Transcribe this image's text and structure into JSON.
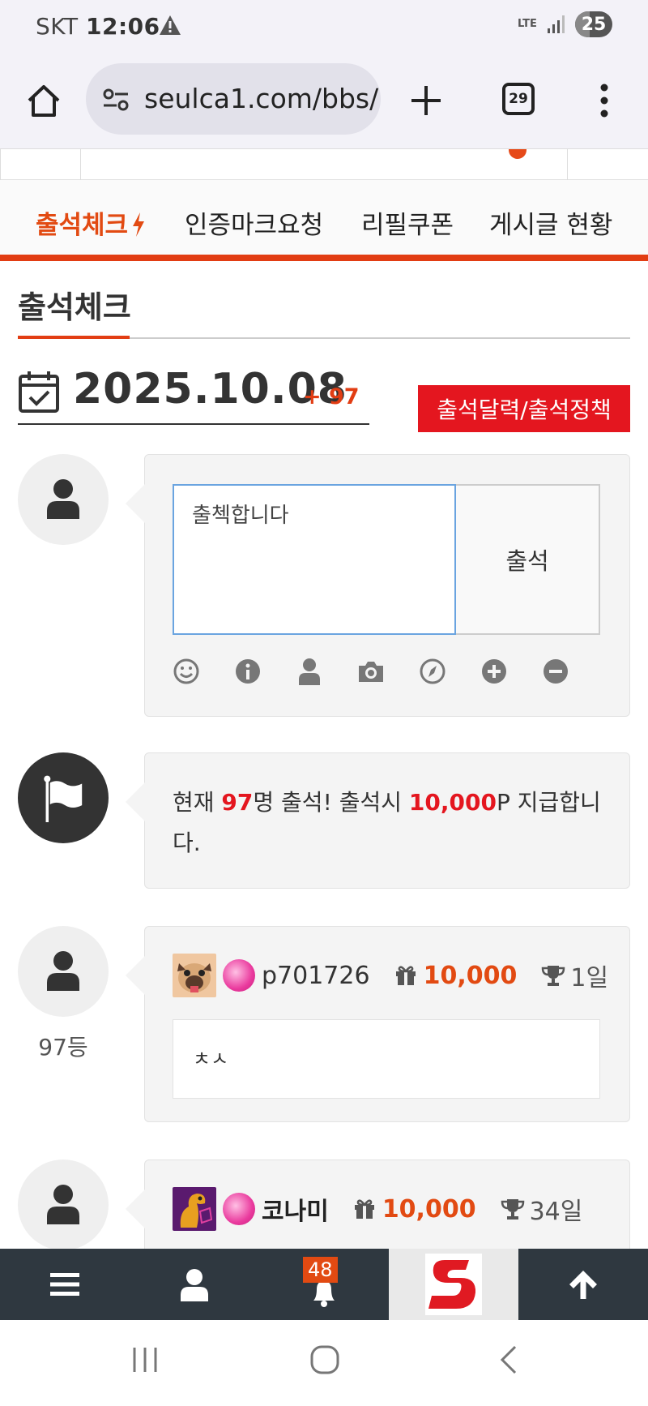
{
  "status_bar": {
    "carrier": "SKT",
    "time": "12:06",
    "network": "LTE",
    "battery": "25"
  },
  "browser": {
    "url": "seulca1.com/bbs/",
    "tab_count": "29"
  },
  "nav": {
    "items": [
      {
        "label": "출석체크",
        "active": true
      },
      {
        "label": "인증마크요청"
      },
      {
        "label": "리필쿠폰"
      },
      {
        "label": "게시글 현황"
      }
    ]
  },
  "page": {
    "title": "출석체크",
    "date": "2025.10.08",
    "count_delta": "+ 97",
    "policy_button": "출석달력/출석정책"
  },
  "compose": {
    "textarea_value": "출첵합니다",
    "submit_label": "출석",
    "tools": [
      "smile-icon",
      "info-icon",
      "user-icon",
      "camera-icon",
      "compass-icon",
      "plus-circle-icon",
      "minus-circle-icon"
    ]
  },
  "notice": {
    "prefix": "현재 ",
    "count": "97",
    "mid": "명 출석! 출석시 ",
    "points": "10,000",
    "suffix": "P 지급합니다."
  },
  "entries": [
    {
      "nickname": "p701726",
      "points": "10,000",
      "days": "1일",
      "message": "ㅊㅅ",
      "rank": "97등"
    },
    {
      "nickname": "코나미",
      "points": "10,000",
      "days": "34일"
    }
  ],
  "bottom_bar": {
    "notification_count": "48"
  },
  "colors": {
    "accent": "#e23d13",
    "red": "#e4161f",
    "bottom_bar": "#2f3840"
  }
}
